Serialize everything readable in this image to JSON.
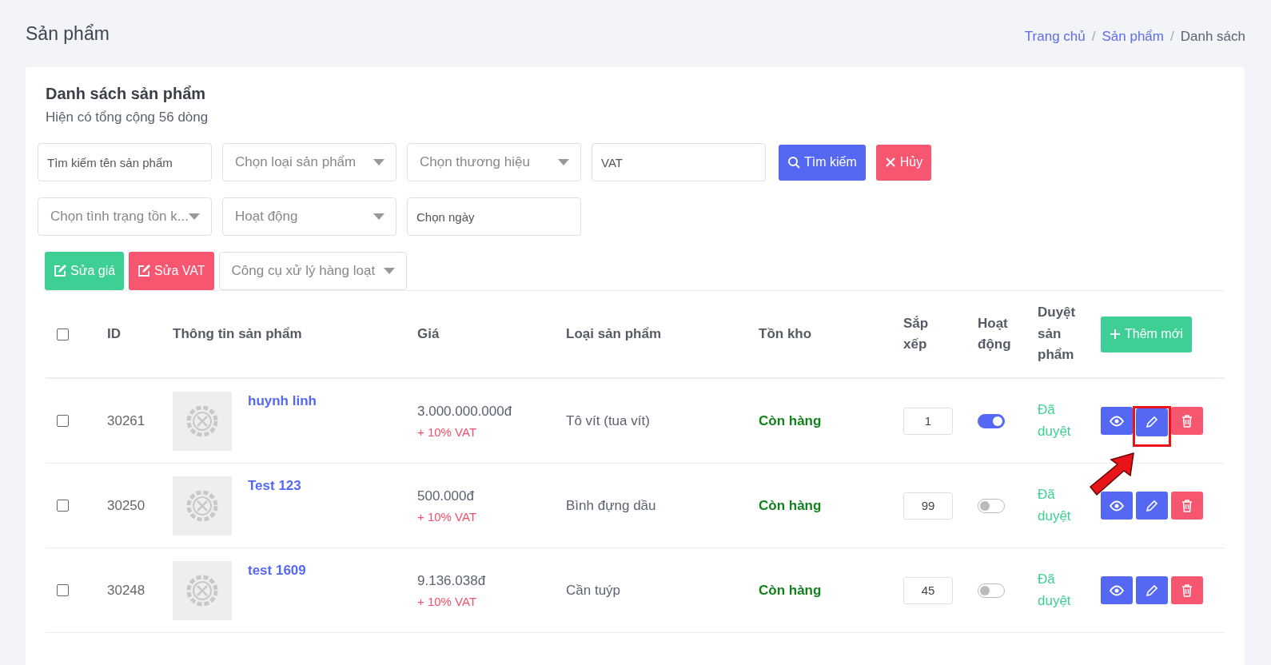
{
  "page_title": "Sản phẩm",
  "breadcrumb": [
    {
      "label": "Trang chủ",
      "link": true
    },
    {
      "label": "Sản phẩm",
      "link": true
    },
    {
      "label": "Danh sách",
      "link": false
    }
  ],
  "breadcrumb_separator": "/",
  "card": {
    "title": "Danh sách sản phẩm",
    "subtitle": "Hiện có tổng cộng 56 dòng"
  },
  "filters_row1": [
    {
      "kind": "input",
      "placeholder": "Tìm kiếm tên sản phẩm"
    },
    {
      "kind": "select",
      "placeholder": "Chọn loại sản phẩm"
    },
    {
      "kind": "select",
      "placeholder": "Chọn thương hiệu"
    },
    {
      "kind": "input",
      "placeholder": "VAT"
    }
  ],
  "search_button": "Tìm kiếm",
  "cancel_button": "Hủy",
  "filters_row2": [
    {
      "kind": "select",
      "placeholder": "Chọn tình trạng tồn k..."
    },
    {
      "kind": "select",
      "placeholder": "Hoạt động"
    },
    {
      "kind": "input",
      "placeholder": "Chọn ngày"
    }
  ],
  "edit_price_button": "Sửa giá",
  "edit_vat_button": "Sửa VAT",
  "bulk_tools": "Công cụ xử lý hàng loạt",
  "columns": [
    "ID",
    "Thông tin sản phẩm",
    "Giá",
    "Loại sản phẩm",
    "Tồn kho",
    "Sắp xếp",
    "Hoạt động",
    "Duyệt sản phẩm"
  ],
  "add_button": "Thêm mới",
  "rows": [
    {
      "checked": false,
      "id": "30261",
      "name": "huynh linh",
      "price": "3.000.000.000đ",
      "vat": "+ 10% VAT",
      "type": "Tô vít (tua vít)",
      "stock": "Còn hàng",
      "sort": "1",
      "active": true,
      "approval": "Đã duyệt",
      "highlighted": true
    },
    {
      "checked": false,
      "id": "30250",
      "name": "Test 123",
      "price": "500.000đ",
      "vat": "+ 10% VAT",
      "type": "Bình đựng dầu",
      "stock": "Còn hàng",
      "sort": "99",
      "active": false,
      "approval": "Đã duyệt",
      "highlighted": false
    },
    {
      "checked": false,
      "id": "30248",
      "name": "test 1609",
      "price": "9.136.038đ",
      "vat": "+ 10% VAT",
      "type": "Cần tuýp",
      "stock": "Còn hàng",
      "sort": "45",
      "active": false,
      "approval": "Đã duyệt",
      "highlighted": false
    }
  ],
  "header_checkbox": {
    "checked": false
  }
}
